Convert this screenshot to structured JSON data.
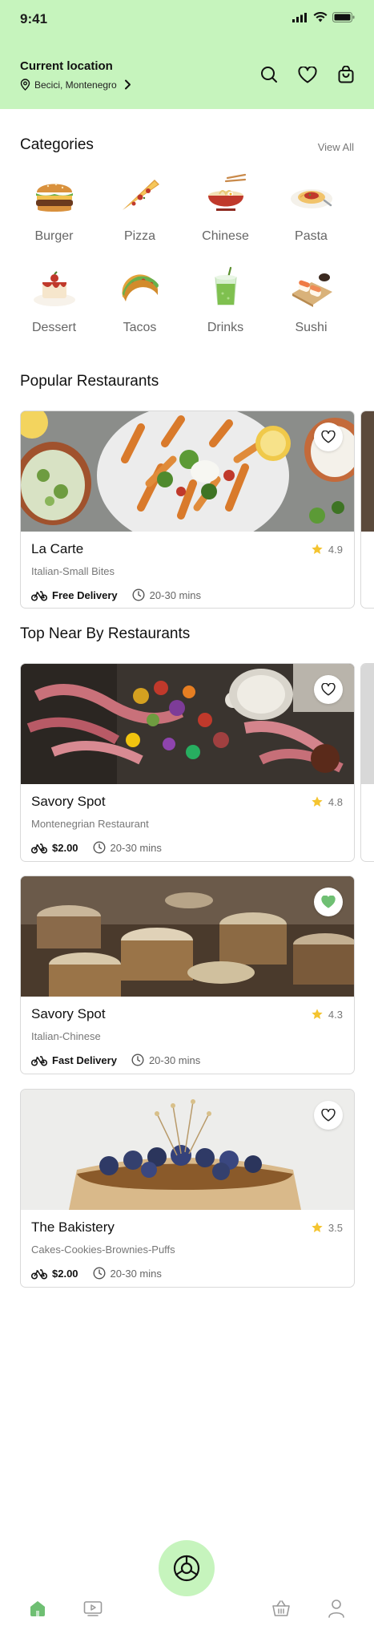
{
  "status_bar": {
    "time": "9:41"
  },
  "header": {
    "location_label": "Current location",
    "location_value": "Becici, Montenegro"
  },
  "categories_section": {
    "title": "Categories",
    "view_all": "View All",
    "items": [
      {
        "label": "Burger",
        "icon": "burger-icon"
      },
      {
        "label": "Pizza",
        "icon": "pizza-icon"
      },
      {
        "label": "Chinese",
        "icon": "noodle-bowl-icon"
      },
      {
        "label": "Pasta",
        "icon": "pasta-icon"
      },
      {
        "label": "Dessert",
        "icon": "cake-icon"
      },
      {
        "label": "Tacos",
        "icon": "taco-icon"
      },
      {
        "label": "Drinks",
        "icon": "drink-icon"
      },
      {
        "label": "Sushi",
        "icon": "sushi-icon"
      }
    ]
  },
  "popular_section": {
    "title": "Popular Restaurants",
    "cards": [
      {
        "name": "La Carte",
        "rating": "4.9",
        "subtitle": "Italian-Small Bites",
        "delivery": "Free Delivery",
        "time": "20-30 mins",
        "favorited": false
      }
    ]
  },
  "nearby_section": {
    "title": "Top Near By Restaurants",
    "cards": [
      {
        "name": "Savory Spot",
        "rating": "4.8",
        "subtitle": "Montenegrian Restaurant",
        "delivery": "$2.00",
        "time": "20-30 mins",
        "favorited": false
      },
      {
        "name": "Savory Spot",
        "rating": "4.3",
        "subtitle": "Italian-Chinese",
        "delivery": "Fast Delivery",
        "time": "20-30 mins",
        "favorited": true
      },
      {
        "name": "The Bakistery",
        "rating": "3.5",
        "subtitle": "Cakes-Cookies-Brownies-Puffs",
        "delivery": "$2.00",
        "time": "20-30 mins",
        "favorited": false
      }
    ]
  },
  "colors": {
    "accent": "#c6f4bd",
    "accent_dark": "#7cc46e",
    "star": "#f4c430",
    "favorite": "#6fbf73"
  }
}
